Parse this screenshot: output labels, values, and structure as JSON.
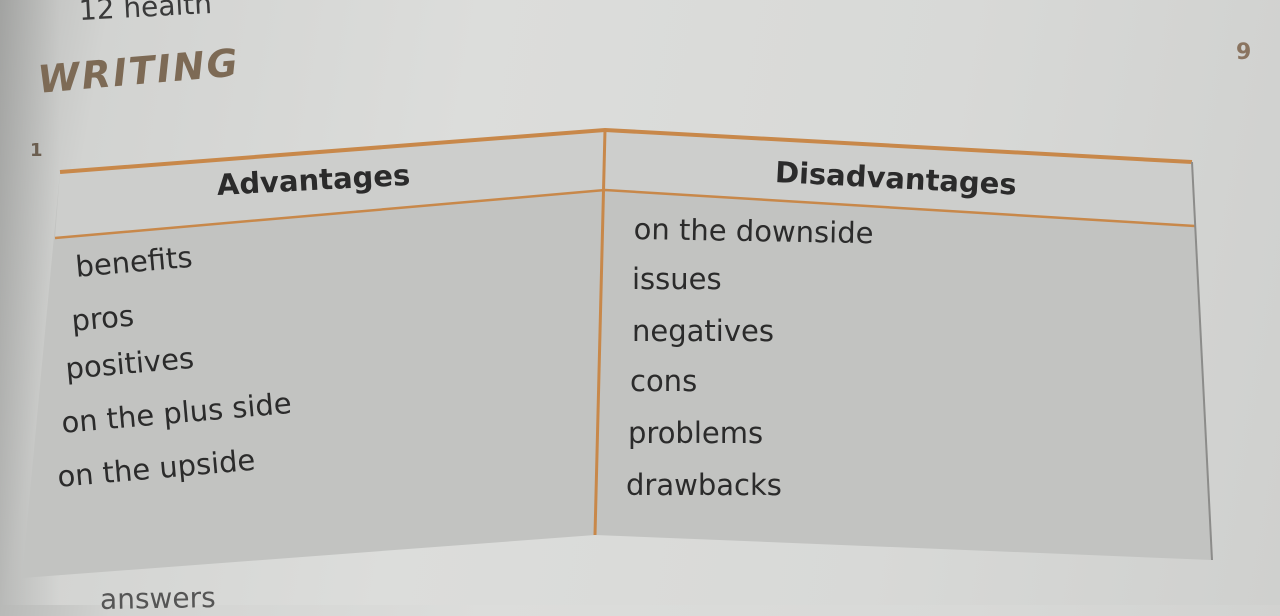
{
  "header": {
    "text": "12 health"
  },
  "page_number": "9",
  "section_title": "WRITING",
  "exercise_number": "1",
  "table": {
    "headers": {
      "advantages": "Advantages",
      "disadvantages": "Disadvantages"
    },
    "advantages": [
      "benefits",
      "pros",
      "positives",
      "on the plus side",
      "on the upside"
    ],
    "disadvantages": [
      "on the downside",
      "issues",
      "negatives",
      "cons",
      "problems",
      "drawbacks"
    ]
  },
  "bottom_text": "answers",
  "colors": {
    "border": "#c8884a",
    "table_bg": "#c2c3c1",
    "header_bg": "#cdcecc",
    "title": "#7d6a55"
  }
}
